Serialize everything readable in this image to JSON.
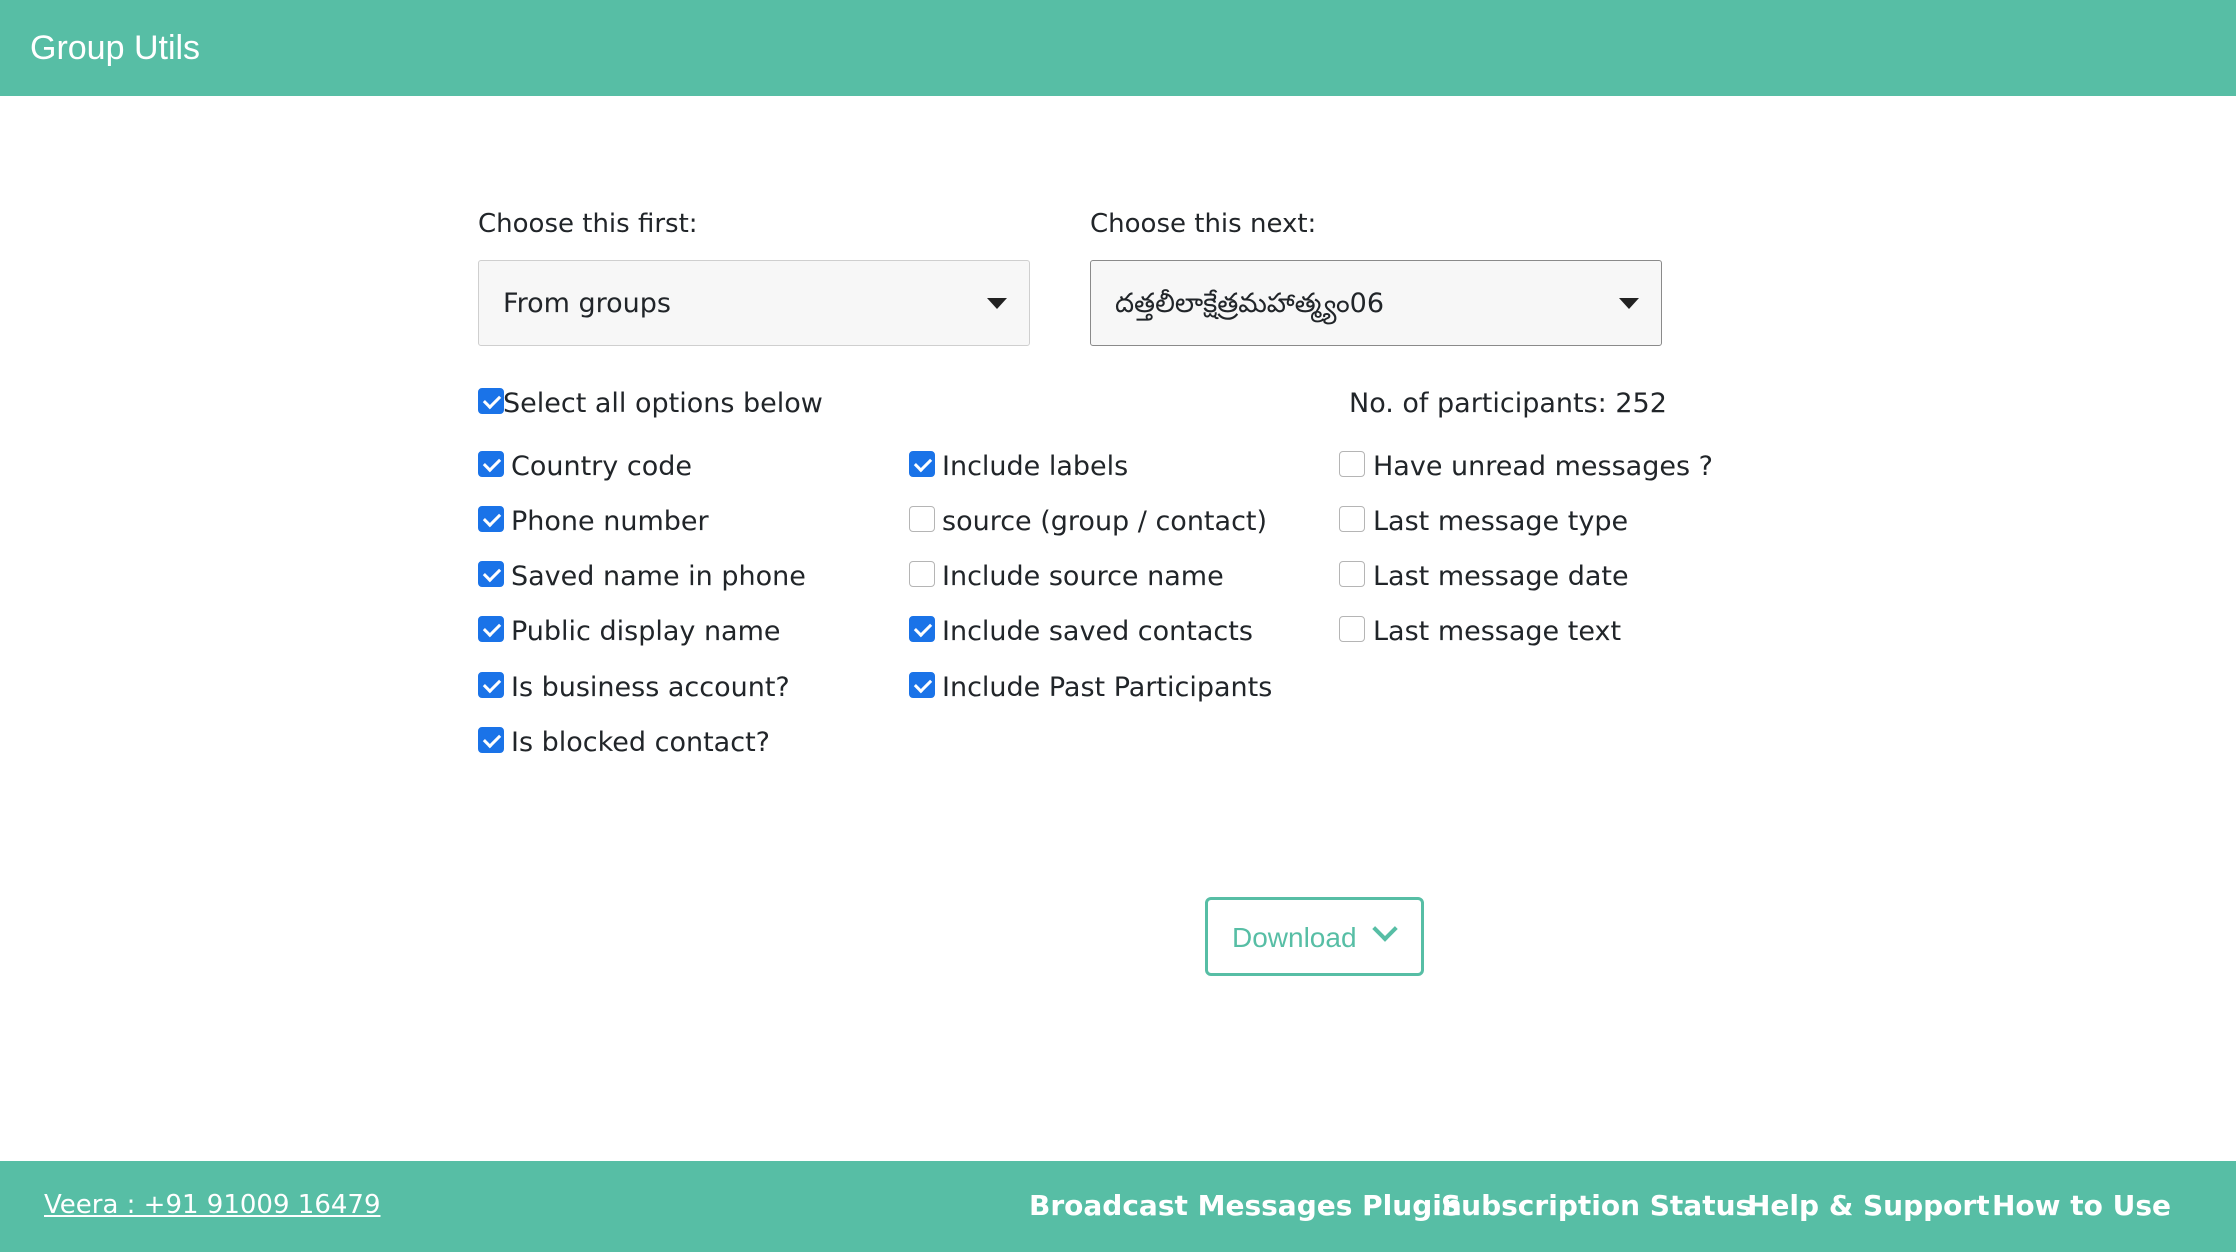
{
  "header": {
    "title": "Group Utils"
  },
  "first_select": {
    "label": "Choose this first:",
    "value": "From groups"
  },
  "next_select": {
    "label": "Choose this next:",
    "value": "దత్తలీలాక్షేత్రమహాత్మ్యం06"
  },
  "select_all": {
    "label": "Select all options below",
    "checked": true
  },
  "participants": {
    "text": "No. of participants: 252"
  },
  "options": {
    "col1": [
      {
        "label": "Country code",
        "checked": true
      },
      {
        "label": "Phone number",
        "checked": true
      },
      {
        "label": "Saved name in phone",
        "checked": true
      },
      {
        "label": "Public display name",
        "checked": true
      },
      {
        "label": "Is business account?",
        "checked": true
      },
      {
        "label": "Is blocked contact?",
        "checked": true
      }
    ],
    "col2": [
      {
        "label": "Include labels",
        "checked": true
      },
      {
        "label": "source (group / contact)",
        "checked": false
      },
      {
        "label": "Include source name",
        "checked": false
      },
      {
        "label": "Include saved contacts",
        "checked": true
      },
      {
        "label": "Include Past Participants",
        "checked": true
      }
    ],
    "col3": [
      {
        "label": "Have unread messages ?",
        "checked": false
      },
      {
        "label": "Last message type",
        "checked": false
      },
      {
        "label": "Last message date",
        "checked": false
      },
      {
        "label": "Last message text",
        "checked": false
      }
    ]
  },
  "download": {
    "label": "Download",
    "icon": "chevron-down-icon"
  },
  "footer": {
    "contact": "Veera : +91 91009 16479",
    "links": [
      "Broadcast Messages Plugin",
      "Subscription Status",
      "Help & Support",
      "How to Use"
    ]
  },
  "colors": {
    "brand": "#57bea5",
    "checkbox": "#1a73e8"
  }
}
